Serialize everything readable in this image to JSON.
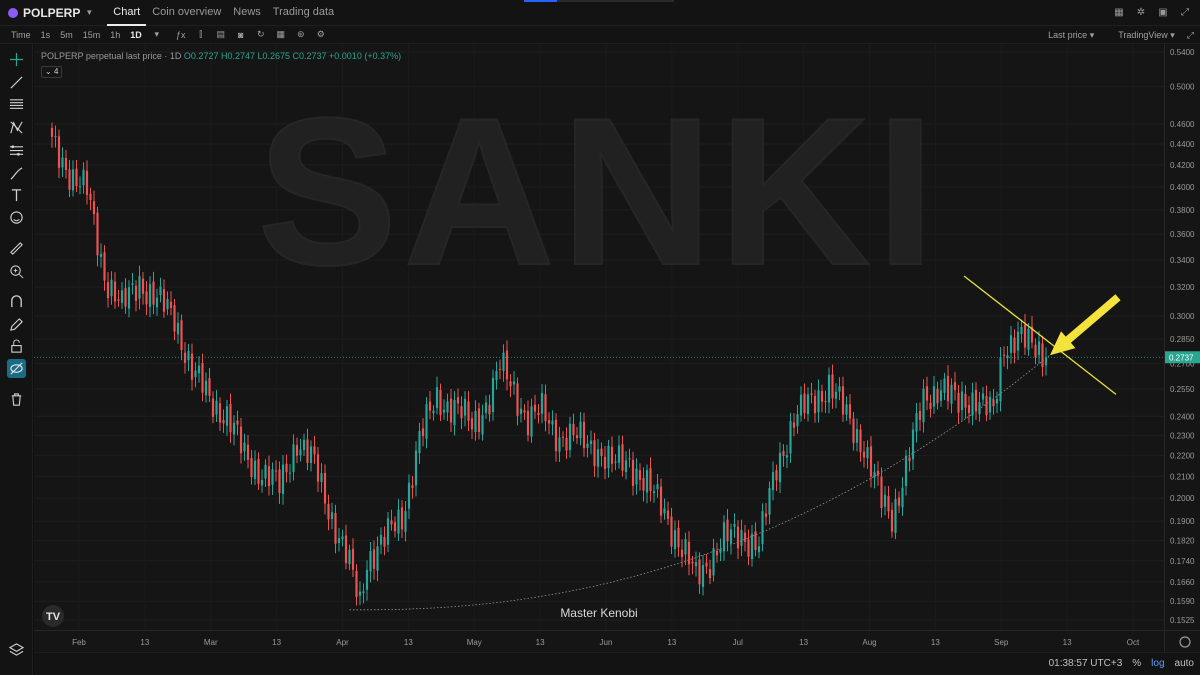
{
  "app": {
    "symbol": "POLPERP",
    "nav": [
      "Chart",
      "Coin overview",
      "News",
      "Trading data"
    ],
    "active_nav": "Chart"
  },
  "toolbar": {
    "time_label": "Time",
    "intervals": [
      "1s",
      "5m",
      "15m",
      "1h",
      "1D"
    ],
    "active_interval": "1D",
    "last_price": "Last price",
    "tradingview": "TradingView"
  },
  "legend": {
    "title": "POLPERP perpetual last price · 1D",
    "ohlc": "O0.2727 H0.2747 L0.2675 C0.2737 +0.0010 (+0.37%)",
    "indicator_count": "4"
  },
  "watermark": "SANKI",
  "annotation": "Master Kenobi",
  "footer": {
    "time": "01:38:57 UTC+3",
    "percent": "%",
    "log": "log",
    "auto": "auto"
  },
  "colors": {
    "up": "#26a69a",
    "down": "#ef5350",
    "trendline": "#e6e03a",
    "arrow": "#f4e33d",
    "curve": "#9a9a9a"
  },
  "chart_data": {
    "type": "candlestick",
    "title": "POLPERP perpetual last price · 1D",
    "y_scale": "log",
    "ylim": [
      0.1525,
      0.54
    ],
    "y_ticks": [
      "0.5400",
      "0.5000",
      "0.4600",
      "0.4400",
      "0.4200",
      "0.4000",
      "0.3800",
      "0.3600",
      "0.3400",
      "0.3200",
      "0.3000",
      "0.2850",
      "0.2700",
      "0.2550",
      "0.2400",
      "0.2300",
      "0.2200",
      "0.2100",
      "0.2000",
      "0.1900",
      "0.1820",
      "0.1740",
      "0.1660",
      "0.1590",
      "0.1525"
    ],
    "x_ticks": [
      "Feb",
      "13",
      "Mar",
      "13",
      "Apr",
      "13",
      "May",
      "13",
      "Jun",
      "13",
      "Jul",
      "13",
      "Aug",
      "13",
      "Sep",
      "13",
      "Oct"
    ],
    "last_close": 0.2737,
    "anchors": [
      [
        0,
        0.44
      ],
      [
        6,
        0.41
      ],
      [
        10,
        0.395
      ],
      [
        15,
        0.33
      ],
      [
        20,
        0.305
      ],
      [
        25,
        0.325
      ],
      [
        30,
        0.31
      ],
      [
        35,
        0.3
      ],
      [
        40,
        0.265
      ],
      [
        45,
        0.25
      ],
      [
        50,
        0.24
      ],
      [
        55,
        0.22
      ],
      [
        60,
        0.212
      ],
      [
        65,
        0.205
      ],
      [
        70,
        0.228
      ],
      [
        75,
        0.215
      ],
      [
        80,
        0.192
      ],
      [
        85,
        0.172
      ],
      [
        88,
        0.158
      ],
      [
        90,
        0.175
      ],
      [
        95,
        0.182
      ],
      [
        100,
        0.192
      ],
      [
        105,
        0.228
      ],
      [
        110,
        0.25
      ],
      [
        115,
        0.245
      ],
      [
        120,
        0.235
      ],
      [
        125,
        0.25
      ],
      [
        128,
        0.268
      ],
      [
        132,
        0.255
      ],
      [
        136,
        0.238
      ],
      [
        140,
        0.242
      ],
      [
        145,
        0.23
      ],
      [
        150,
        0.228
      ],
      [
        155,
        0.225
      ],
      [
        160,
        0.215
      ],
      [
        165,
        0.218
      ],
      [
        170,
        0.205
      ],
      [
        175,
        0.195
      ],
      [
        180,
        0.178
      ],
      [
        184,
        0.168
      ],
      [
        188,
        0.175
      ],
      [
        192,
        0.182
      ],
      [
        197,
        0.185
      ],
      [
        202,
        0.18
      ],
      [
        207,
        0.215
      ],
      [
        212,
        0.238
      ],
      [
        217,
        0.248
      ],
      [
        222,
        0.258
      ],
      [
        227,
        0.24
      ],
      [
        232,
        0.225
      ],
      [
        237,
        0.198
      ],
      [
        240,
        0.192
      ],
      [
        244,
        0.215
      ],
      [
        249,
        0.248
      ],
      [
        254,
        0.258
      ],
      [
        259,
        0.245
      ],
      [
        264,
        0.252
      ],
      [
        269,
        0.24
      ],
      [
        272,
        0.28
      ],
      [
        276,
        0.29
      ],
      [
        280,
        0.278
      ],
      [
        284,
        0.2737
      ]
    ]
  }
}
